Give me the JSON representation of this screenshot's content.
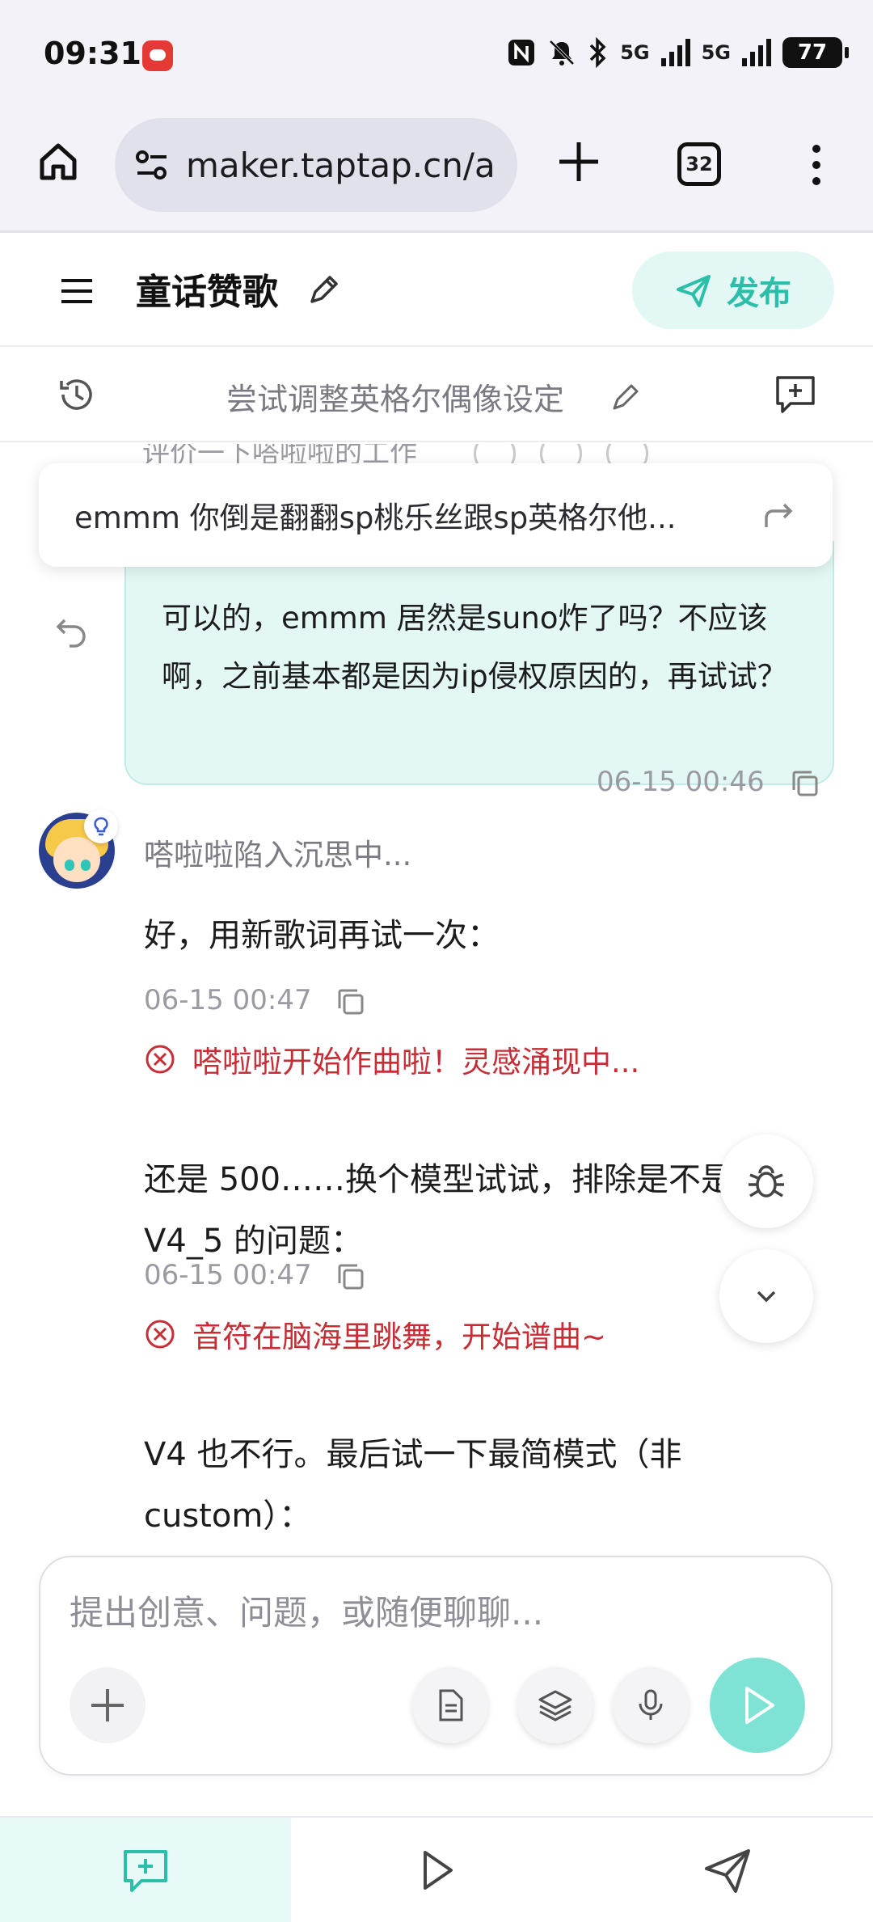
{
  "status_bar": {
    "time": "09:31",
    "network_1": "5G",
    "network_2": "5G",
    "battery": "77",
    "icons": [
      "nfc-icon",
      "mute-icon",
      "bluetooth-icon",
      "signal-icon",
      "battery-icon"
    ]
  },
  "browser": {
    "url": "maker.taptap.cn/a",
    "tab_count": "32"
  },
  "header": {
    "title": "童话赞歌",
    "publish_label": "发布"
  },
  "subheader": {
    "session_title": "尝试调整英格尔偶像设定"
  },
  "chat": {
    "peek_text": "评价一下嗒啦啦的工作",
    "quote_text": "emmm 你倒是翻翻sp桃乐丝跟sp英格尔他...",
    "user_message": "可以的，emmm 居然是suno炸了吗？不应该啊，之前基本都是因为ip侵权原因的，再试试？",
    "user_time": "06-15 00:46",
    "assistant_status": "嗒啦啦陷入沉思中...",
    "messages": [
      {
        "text": "好，用新歌词再试一次：",
        "time": "06-15 00:47",
        "status": "嗒啦啦开始作曲啦！灵感涌现中..."
      },
      {
        "text": "还是 500……换个模型试试，排除是不是 V4_5 的问题：",
        "time": "06-15 00:47",
        "status": "音符在脑海里跳舞，开始谱曲~"
      },
      {
        "text": "V4 也不行。最后试一下最简模式（非 custom）："
      }
    ]
  },
  "input": {
    "placeholder": "提出创意、问题，或随便聊聊..."
  },
  "colors": {
    "accent": "#2bbfa9",
    "accent_light": "#e3f8f5",
    "error": "#c62d35"
  }
}
